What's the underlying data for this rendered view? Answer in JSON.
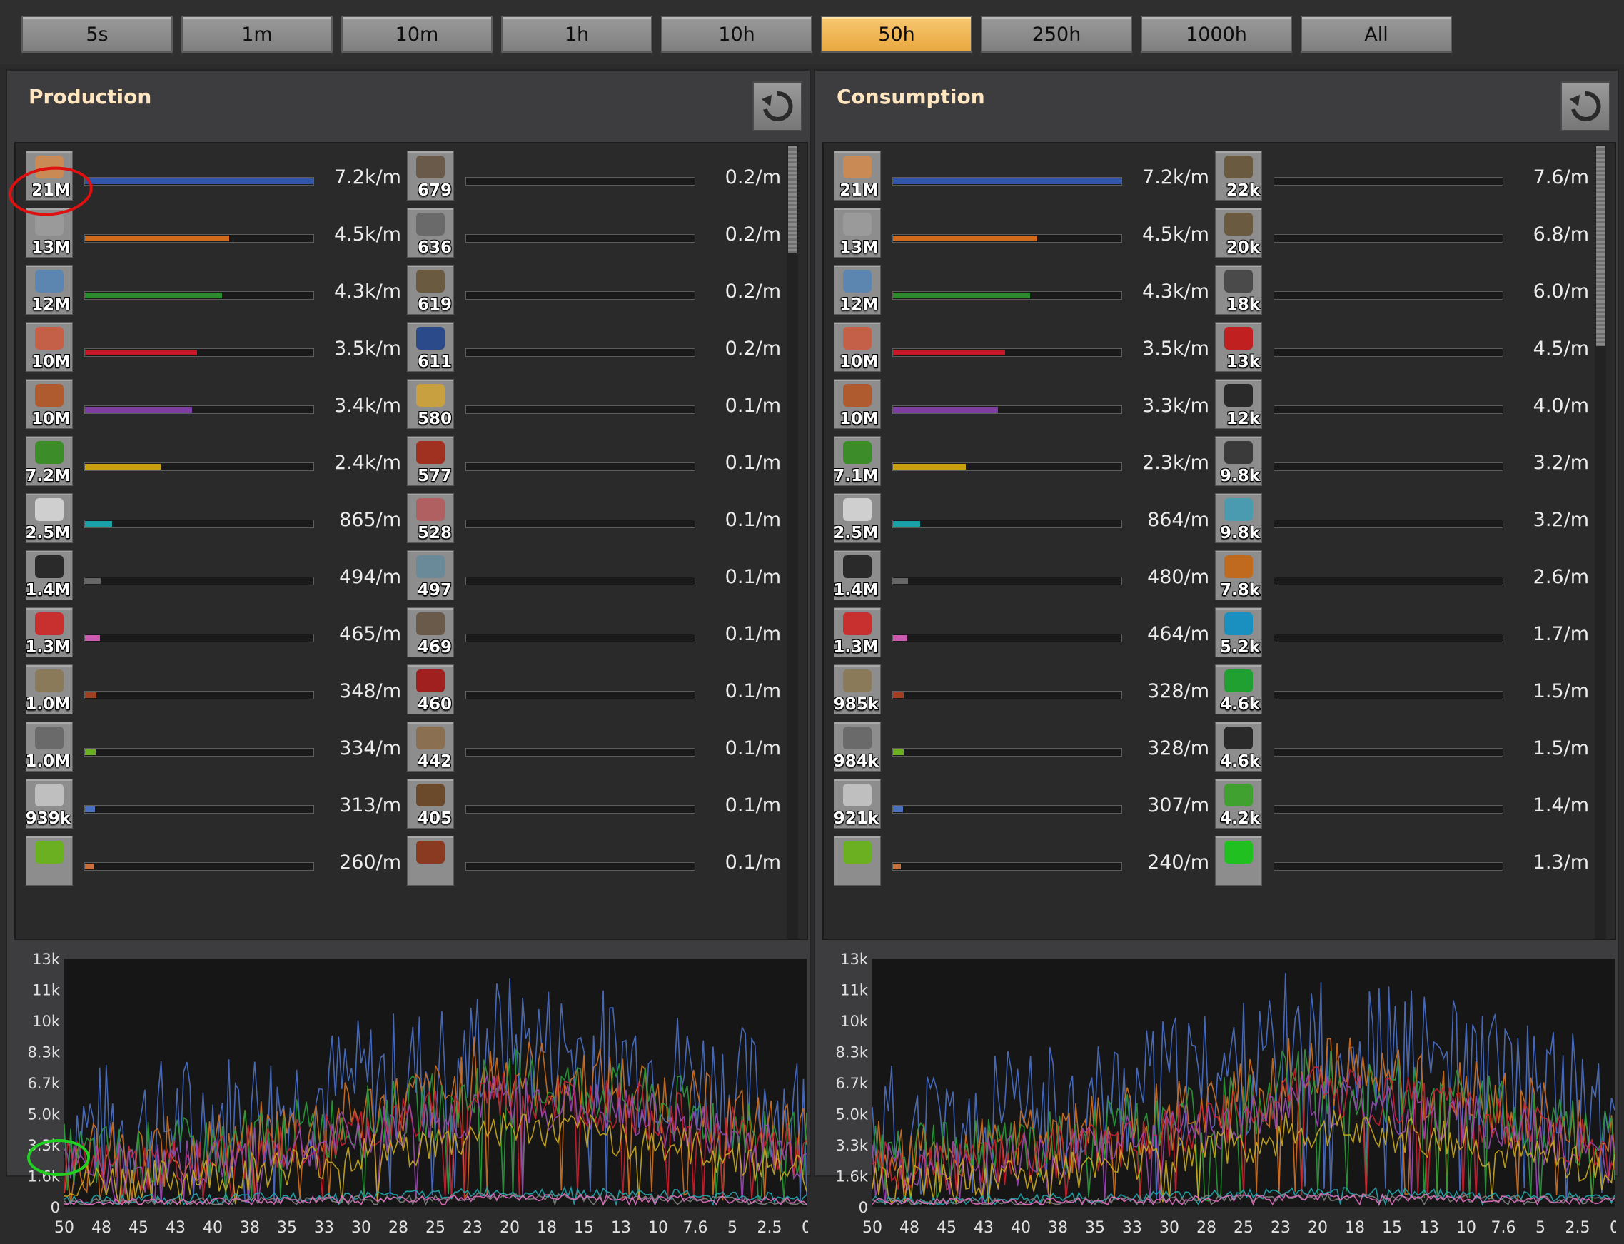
{
  "tabs": [
    {
      "label": "5s",
      "active": false
    },
    {
      "label": "1m",
      "active": false
    },
    {
      "label": "10m",
      "active": false
    },
    {
      "label": "1h",
      "active": false
    },
    {
      "label": "10h",
      "active": false
    },
    {
      "label": "50h",
      "active": true
    },
    {
      "label": "250h",
      "active": false
    },
    {
      "label": "1000h",
      "active": false
    },
    {
      "label": "All",
      "active": false
    }
  ],
  "production": {
    "title": "Production",
    "reset_icon": "reset-icon",
    "left_items": [
      {
        "count": "21M",
        "rate": "7.2k/m",
        "fill": 1.0,
        "color": "#2f56a8",
        "icon": "copper-cable-icon",
        "icolor": "#c98a56"
      },
      {
        "count": "13M",
        "rate": "4.5k/m",
        "fill": 0.63,
        "color": "#d06a1c",
        "icon": "stone-brick-icon",
        "icolor": "#9a9a9a"
      },
      {
        "count": "12M",
        "rate": "4.3k/m",
        "fill": 0.6,
        "color": "#2b8a2b",
        "icon": "iron-ore-icon",
        "icolor": "#5c86b0"
      },
      {
        "count": "10M",
        "rate": "3.5k/m",
        "fill": 0.49,
        "color": "#c4182a",
        "icon": "copper-plate-icon",
        "icolor": "#c46048"
      },
      {
        "count": "10M",
        "rate": "3.4k/m",
        "fill": 0.47,
        "color": "#7f3fa0",
        "icon": "copper-ore-icon",
        "icolor": "#b05a30"
      },
      {
        "count": "7.2M",
        "rate": "2.4k/m",
        "fill": 0.33,
        "color": "#c8a010",
        "icon": "electronic-circuit-icon",
        "icolor": "#3d8c2a"
      },
      {
        "count": "2.5M",
        "rate": "865/m",
        "fill": 0.12,
        "color": "#1aa0a8",
        "icon": "steel-plate-icon",
        "icolor": "#cfcfcf"
      },
      {
        "count": "1.4M",
        "rate": "494/m",
        "fill": 0.07,
        "color": "#666666",
        "icon": "coal-icon",
        "icolor": "#2a2a2a"
      },
      {
        "count": "1.3M",
        "rate": "465/m",
        "fill": 0.065,
        "color": "#c85ab0",
        "icon": "advanced-circuit-icon",
        "icolor": "#c83030"
      },
      {
        "count": "1.0M",
        "rate": "348/m",
        "fill": 0.05,
        "color": "#a04020",
        "icon": "stone-icon",
        "icolor": "#8a7a5a"
      },
      {
        "count": "1.0M",
        "rate": "334/m",
        "fill": 0.048,
        "color": "#6ab020",
        "icon": "iron-gear-wheel-icon",
        "icolor": "#6a6a6a"
      },
      {
        "count": "939k",
        "rate": "313/m",
        "fill": 0.045,
        "color": "#4a70c0",
        "icon": "iron-stick-icon",
        "icolor": "#bfbfbf"
      },
      {
        "count": "",
        "rate": "260/m",
        "fill": 0.037,
        "color": "#c87040",
        "icon": "green-item-icon",
        "icolor": "#6ab020"
      }
    ],
    "right_items": [
      {
        "count": "679",
        "rate": "0.2/m",
        "icon": "big-mining-drill-icon",
        "icolor": "#6a5a4a"
      },
      {
        "count": "636",
        "rate": "0.2/m",
        "icon": "robot-icon",
        "icolor": "#6a6a6a"
      },
      {
        "count": "619",
        "rate": "0.2/m",
        "icon": "assembling-machine-icon",
        "icolor": "#6a5a40"
      },
      {
        "count": "611",
        "rate": "0.2/m",
        "icon": "assembling-machine-blue-icon",
        "icolor": "#2a4a8a"
      },
      {
        "count": "580",
        "rate": "0.1/m",
        "icon": "underground-belt-icon",
        "icolor": "#c8a040"
      },
      {
        "count": "577",
        "rate": "0.1/m",
        "icon": "locomotive-icon",
        "icolor": "#a03020"
      },
      {
        "count": "528",
        "rate": "0.1/m",
        "icon": "pipe-to-ground-icon",
        "icolor": "#b06060"
      },
      {
        "count": "497",
        "rate": "0.1/m",
        "icon": "inserter-icon",
        "icolor": "#6a8a9a"
      },
      {
        "count": "469",
        "rate": "0.1/m",
        "icon": "cargo-wagon-icon",
        "icolor": "#6a5a4a"
      },
      {
        "count": "460",
        "rate": "0.1/m",
        "icon": "red-underground-belt-icon",
        "icolor": "#a02020"
      },
      {
        "count": "442",
        "rate": "0.1/m",
        "icon": "rail-icon",
        "icolor": "#8a7050"
      },
      {
        "count": "405",
        "rate": "0.1/m",
        "icon": "wooden-chest-icon",
        "icolor": "#6a4a2a"
      },
      {
        "count": "",
        "rate": "0.1/m",
        "icon": "brown-item-icon",
        "icolor": "#8a3a20"
      }
    ],
    "chart": {
      "ylabels": [
        "13k",
        "11k",
        "10k",
        "8.3k",
        "6.7k",
        "5.0k",
        "3.3k",
        "1.6k",
        "0"
      ],
      "xlabels": [
        "50",
        "48",
        "45",
        "43",
        "40",
        "38",
        "35",
        "33",
        "30",
        "28",
        "25",
        "23",
        "20",
        "18",
        "15",
        "13",
        "10",
        "7.6",
        "5",
        "2.5",
        "0"
      ]
    }
  },
  "consumption": {
    "title": "Consumption",
    "reset_icon": "reset-icon",
    "left_items": [
      {
        "count": "21M",
        "rate": "7.2k/m",
        "fill": 1.0,
        "color": "#2f56a8",
        "icon": "copper-cable-icon",
        "icolor": "#c98a56"
      },
      {
        "count": "13M",
        "rate": "4.5k/m",
        "fill": 0.63,
        "color": "#d06a1c",
        "icon": "stone-brick-icon",
        "icolor": "#9a9a9a"
      },
      {
        "count": "12M",
        "rate": "4.3k/m",
        "fill": 0.6,
        "color": "#2b8a2b",
        "icon": "iron-ore-icon",
        "icolor": "#5c86b0"
      },
      {
        "count": "10M",
        "rate": "3.5k/m",
        "fill": 0.49,
        "color": "#c4182a",
        "icon": "copper-plate-icon",
        "icolor": "#c46048"
      },
      {
        "count": "10M",
        "rate": "3.3k/m",
        "fill": 0.46,
        "color": "#7f3fa0",
        "icon": "copper-ore-icon",
        "icolor": "#b05a30"
      },
      {
        "count": "7.1M",
        "rate": "2.3k/m",
        "fill": 0.32,
        "color": "#c8a010",
        "icon": "electronic-circuit-icon",
        "icolor": "#3d8c2a"
      },
      {
        "count": "2.5M",
        "rate": "864/m",
        "fill": 0.12,
        "color": "#1aa0a8",
        "icon": "steel-plate-icon",
        "icolor": "#cfcfcf"
      },
      {
        "count": "1.4M",
        "rate": "480/m",
        "fill": 0.067,
        "color": "#666666",
        "icon": "coal-icon",
        "icolor": "#2a2a2a"
      },
      {
        "count": "1.3M",
        "rate": "464/m",
        "fill": 0.064,
        "color": "#c85ab0",
        "icon": "advanced-circuit-icon",
        "icolor": "#c83030"
      },
      {
        "count": "985k",
        "rate": "328/m",
        "fill": 0.046,
        "color": "#a04020",
        "icon": "stone-icon",
        "icolor": "#8a7a5a"
      },
      {
        "count": "984k",
        "rate": "328/m",
        "fill": 0.046,
        "color": "#6ab020",
        "icon": "iron-gear-wheel-icon",
        "icolor": "#6a6a6a"
      },
      {
        "count": "921k",
        "rate": "307/m",
        "fill": 0.043,
        "color": "#4a70c0",
        "icon": "iron-stick-icon",
        "icolor": "#bfbfbf"
      },
      {
        "count": "",
        "rate": "240/m",
        "fill": 0.033,
        "color": "#c87040",
        "icon": "green-item-icon",
        "icolor": "#6ab020"
      }
    ],
    "right_items": [
      {
        "count": "22k",
        "rate": "7.6/m",
        "icon": "research-pack-chest-icon",
        "icolor": "#6a5a40"
      },
      {
        "count": "20k",
        "rate": "6.8/m",
        "icon": "engine-unit-icon",
        "icolor": "#6a5a40"
      },
      {
        "count": "18k",
        "rate": "6.0/m",
        "icon": "furnace-icon",
        "icolor": "#4a4a4a"
      },
      {
        "count": "13k",
        "rate": "4.5/m",
        "icon": "rocket-icon",
        "icolor": "#c02020"
      },
      {
        "count": "12k",
        "rate": "4.0/m",
        "icon": "barrel-icon",
        "icolor": "#2a2a2a"
      },
      {
        "count": "9.8k",
        "rate": "3.2/m",
        "icon": "wall-icon",
        "icolor": "#3a3a3a"
      },
      {
        "count": "9.8k",
        "rate": "3.2/m",
        "icon": "solar-icon",
        "icolor": "#4a9ab0"
      },
      {
        "count": "7.8k",
        "rate": "2.6/m",
        "icon": "battery-icon",
        "icolor": "#c06a20"
      },
      {
        "count": "5.2k",
        "rate": "1.7/m",
        "icon": "speed-module-icon",
        "icolor": "#1a90c0"
      },
      {
        "count": "4.6k",
        "rate": "1.5/m",
        "icon": "green-flask-icon",
        "icolor": "#20a030"
      },
      {
        "count": "4.6k",
        "rate": "1.5/m",
        "icon": "black-flask-icon",
        "icolor": "#2a2a2a"
      },
      {
        "count": "4.2k",
        "rate": "1.4/m",
        "icon": "efficiency-module-icon",
        "icolor": "#40a030"
      },
      {
        "count": "",
        "rate": "1.3/m",
        "icon": "green-glow-icon",
        "icolor": "#20c020"
      }
    ],
    "chart": {
      "ylabels": [
        "13k",
        "11k",
        "10k",
        "8.3k",
        "6.7k",
        "5.0k",
        "3.3k",
        "1.6k",
        "0"
      ],
      "xlabels": [
        "50",
        "48",
        "45",
        "43",
        "40",
        "38",
        "35",
        "33",
        "30",
        "28",
        "25",
        "23",
        "20",
        "18",
        "15",
        "13",
        "10",
        "7.6",
        "5",
        "2.5",
        "0"
      ]
    }
  },
  "colors": {
    "tab_active": "#f0b857",
    "panel_bg": "#3d3d3f",
    "chart_bg": "#161616",
    "annotation_red": "#e01010",
    "annotation_green": "#20d020"
  }
}
